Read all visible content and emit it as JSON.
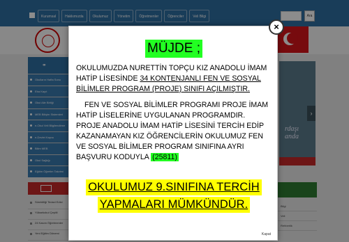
{
  "page": {
    "nav_items": [
      "Kurumsal",
      "Hakkımızda",
      "Okulumuz",
      "Yönetim",
      "Öğretmenler",
      "Öğrenciler",
      "Veli Bilgi"
    ],
    "search_button": "Ara",
    "sidebar_items": [
      "Okulların Hafta Sonu",
      "Eba Kayıt",
      "Okul Aile Birliği",
      "MEB Bilişim Sistemleri",
      "e-Okul Veli Bilgilendirme",
      "e-Devlet Kapısı",
      "Bilim MEB",
      "Okul Sağlığı",
      "Eğitim Öğretim Takvimi",
      "Mesleki Öğretim"
    ],
    "news_items": [
      "Sürekliliği Tedavi Edici",
      "Yüksekokul Çeşitli",
      "24 Kasım Öğretmenler",
      "Yeni Eğitim Dönemi"
    ],
    "slider_caption": "rdaşı anda",
    "right_items": [
      "Bilgi",
      "Veli",
      "Rehberlik"
    ]
  },
  "modal": {
    "close_label": "×",
    "title": "MÜJDE ;",
    "para_1_part_a": "OKULUMUZDA NURETTİN TOPÇU KIZ ANADOLU İMAM HATİP LİSESİNDE ",
    "para_1_underlined": "34 KONTENJANLI FEN VE SOSYAL BİLİMLER PROGRAM (PROJE) SINIFI AÇILMIŞTIR.",
    "para_2": "FEN VE SOSYAL BİLİMLER PROGRAMI PROJE İMAM HATİP LİSELERİNE UYGULANAN PROGRAMDIR.",
    "para_3": "PROJE ANADOLU İMAM HATİP LİSESİNİ TERCİH EDİP KAZANAMAYAN KIZ ÖĞRENCİLERİN OKULUMUZ FEN VE SOSYAL BİLİMLER PROGRAM SINIFINA AYRI BAŞVURU KODUYLA",
    "code": "(25811)",
    "cta_line_1": "OKULUMUZ 9.SINIFINA TERCİH",
    "cta_line_2": "YAPMALARI MÜMKÜNDÜR.",
    "footer_close": "Kapat"
  }
}
